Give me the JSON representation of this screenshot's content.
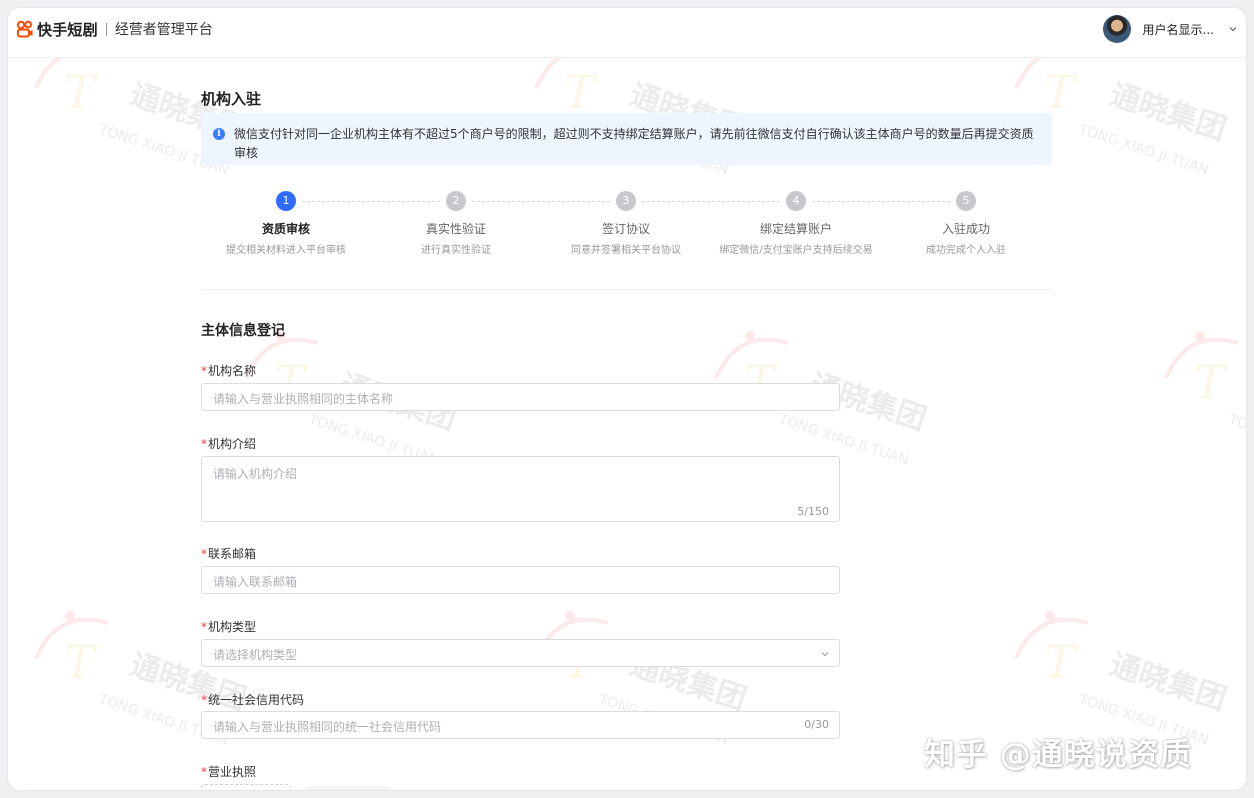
{
  "app": {
    "brand_name": "快手短剧",
    "platform_name": "经营者管理平台",
    "user_name": "用户名显示..."
  },
  "page": {
    "title": "机构入驻",
    "notice": "微信支付针对同一企业机构主体有不超过5个商户号的限制，超过则不支持绑定结算账户，请先前往微信支付自行确认该主体商户号的数量后再提交资质审核"
  },
  "steps": [
    {
      "num": "1",
      "label": "资质审核",
      "desc": "提交相关材料进入平台审核",
      "active": true
    },
    {
      "num": "2",
      "label": "真实性验证",
      "desc": "进行真实性验证",
      "active": false
    },
    {
      "num": "3",
      "label": "签订协议",
      "desc": "同意并签署相关平台协议",
      "active": false
    },
    {
      "num": "4",
      "label": "绑定结算账户",
      "desc": "绑定微信/支付宝账户支持后续交易",
      "active": false
    },
    {
      "num": "5",
      "label": "入驻成功",
      "desc": "成功完成个人入驻",
      "active": false
    }
  ],
  "form": {
    "section_title": "主体信息登记",
    "required_mark": "*",
    "org_name": {
      "label": "机构名称",
      "placeholder": "请输入与营业执照相同的主体名称"
    },
    "org_intro": {
      "label": "机构介绍",
      "placeholder": "请输入机构介绍",
      "counter": "5/150"
    },
    "email": {
      "label": "联系邮箱",
      "placeholder": "请输入联系邮箱"
    },
    "org_type": {
      "label": "机构类型",
      "placeholder": "请选择机构类型"
    },
    "credit_code": {
      "label": "统一社会信用代码",
      "placeholder": "请输入与营业执照相同的统一社会信用代码",
      "counter": "0/30"
    },
    "license": {
      "label": "营业执照"
    }
  },
  "watermark": {
    "company_cn": "通晓集团",
    "company_en": "TONG XIAO JI TUAN",
    "zhihu": "知乎 @通晓说资质"
  },
  "colors": {
    "primary": "#2f6bff",
    "notice_bg": "#eef5ff",
    "required": "#f04040",
    "brand": "#ff4906"
  },
  "icons": {
    "brand_logo": "kuaishou-logo-icon",
    "notice": "info-icon",
    "dropdown": "chevron-down-icon"
  }
}
